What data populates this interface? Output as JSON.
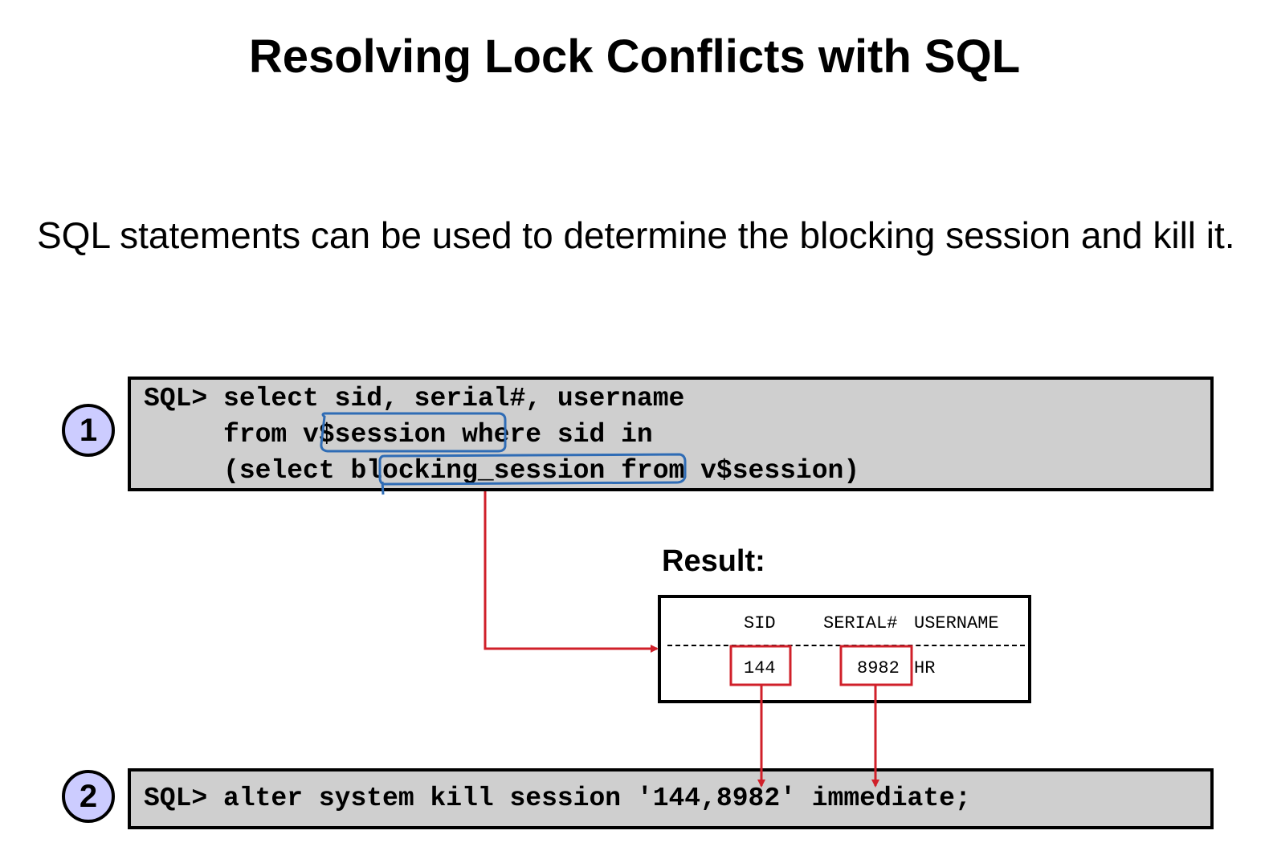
{
  "title": "Resolving Lock Conflicts with SQL",
  "body_text": "SQL statements can be used to determine the blocking session and kill it.",
  "step1": {
    "number": "1",
    "code_lines": [
      "SQL> select sid, serial#, username",
      "     from v$session where sid in",
      "     (select blocking_session from v$session)"
    ]
  },
  "result": {
    "label": "Result:",
    "columns": [
      "SID",
      "SERIAL#",
      "USERNAME"
    ],
    "row": [
      "144",
      "8982",
      "HR"
    ]
  },
  "step2": {
    "number": "2",
    "code_line": "SQL> alter system kill session '144,8982' immediate;"
  },
  "colors": {
    "highlight_blue": "#2f6cb5",
    "arrow_red": "#d0202a",
    "code_background": "#cfcfcf",
    "badge_fill": "#ccccff"
  }
}
